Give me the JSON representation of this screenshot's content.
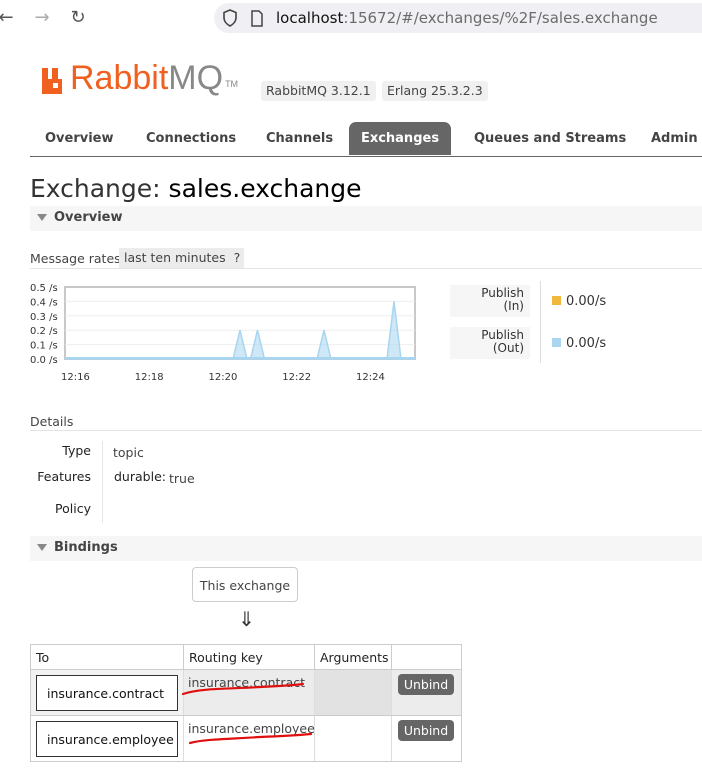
{
  "browser": {
    "url_host": "localhost",
    "url_rest": ":15672/#/exchanges/%2F/sales.exchange"
  },
  "header": {
    "logo_rabbit": "Rabbit",
    "logo_mq": "MQ",
    "logo_tm": "TM",
    "version_rabbitmq": "RabbitMQ 3.12.1",
    "version_erlang": "Erlang 25.3.2.3"
  },
  "tabs": [
    {
      "label": "Overview"
    },
    {
      "label": "Connections"
    },
    {
      "label": "Channels"
    },
    {
      "label": "Exchanges",
      "active": true
    },
    {
      "label": "Queues and Streams"
    },
    {
      "label": "Admin"
    }
  ],
  "page": {
    "title_prefix": "Exchange:",
    "title_name": "sales.exchange"
  },
  "overview": {
    "section_label": "Overview",
    "rates_label": "Message rates",
    "rates_range": "last ten minutes",
    "rates_help": "?",
    "legend": [
      {
        "line1": "Publish",
        "line2": "(In)",
        "value": "0.00/s",
        "color": "#eeb93d"
      },
      {
        "line1": "Publish",
        "line2": "(Out)",
        "value": "0.00/s",
        "color": "#a8d5f0"
      }
    ]
  },
  "chart_data": {
    "type": "area",
    "x_ticks": [
      "12:16",
      "12:18",
      "12:20",
      "12:22",
      "12:24"
    ],
    "y_ticks": [
      "0.0 /s",
      "0.1 /s",
      "0.2 /s",
      "0.3 /s",
      "0.4 /s",
      "0.5 /s"
    ],
    "ylim": [
      0,
      0.5
    ],
    "xlim_minutes": [
      12.0,
      22.0
    ],
    "series": [
      {
        "name": "Publish (Out)",
        "color": "#a8d5f0",
        "points": [
          [
            12.0,
            0
          ],
          [
            16.8,
            0
          ],
          [
            17.0,
            0.2
          ],
          [
            17.2,
            0
          ],
          [
            17.3,
            0
          ],
          [
            17.5,
            0.2
          ],
          [
            17.7,
            0
          ],
          [
            19.2,
            0
          ],
          [
            19.4,
            0.2
          ],
          [
            19.6,
            0
          ],
          [
            21.2,
            0
          ],
          [
            21.4,
            0.4
          ],
          [
            21.6,
            0
          ],
          [
            22.0,
            0
          ]
        ]
      }
    ],
    "grid": true
  },
  "details": {
    "section_label": "Details",
    "type_key": "Type",
    "type_value": "topic",
    "features_key": "Features",
    "durable_key": "durable:",
    "durable_value": "true",
    "policy_key": "Policy"
  },
  "bindings": {
    "section_label": "Bindings",
    "this_exchange": "This exchange",
    "arrow": "⇓",
    "columns": [
      "To",
      "Routing key",
      "Arguments",
      ""
    ],
    "rows": [
      {
        "to": "insurance.contract",
        "routing_key": "insurance.contract",
        "unbind": "Unbind"
      },
      {
        "to": "insurance.employee",
        "routing_key": "insurance.employee",
        "unbind": "Unbind"
      }
    ]
  }
}
